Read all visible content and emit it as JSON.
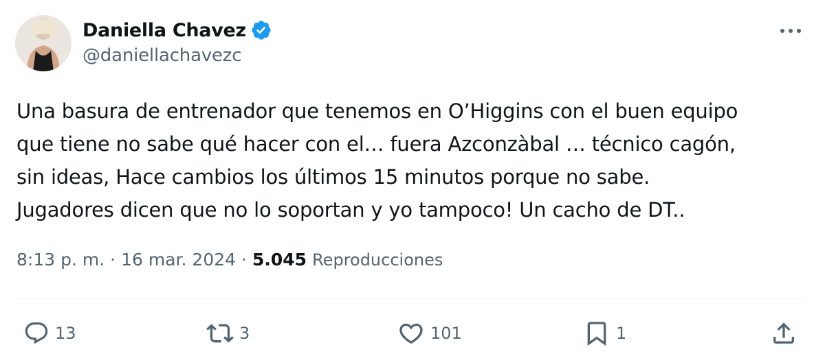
{
  "author": {
    "display_name": "Daniella Chavez",
    "handle": "@daniellachavezc",
    "verified": true,
    "verified_color": "#1d9bf0"
  },
  "tweet": {
    "lines": [
      "Una basura de entrenador que tenemos en O’Higgins con el buen equipo",
      "que tiene no sabe qué hacer con el… fuera Azconzàbal … técnico cagón,",
      "sin ideas, Hace cambios los últimos 15 minutos porque no sabe.",
      "Jugadores dicen que no lo soportan y yo tampoco!  Un cacho de DT.."
    ]
  },
  "meta": {
    "time": "8:13 p. m.",
    "separator": "·",
    "date": "16 mar. 2024",
    "views_count": "5.045",
    "views_label": "Reproducciones"
  },
  "actions": {
    "reply_count": "13",
    "retweet_count": "3",
    "like_count": "101",
    "bookmark_count": "1"
  },
  "icons": {
    "more": "more-horizontal-icon",
    "reply": "reply-icon",
    "retweet": "retweet-icon",
    "like": "heart-icon",
    "bookmark": "bookmark-icon",
    "share": "share-icon"
  },
  "colors": {
    "text_primary": "#0f1419",
    "text_secondary": "#536471",
    "divider": "#eff3f4"
  }
}
